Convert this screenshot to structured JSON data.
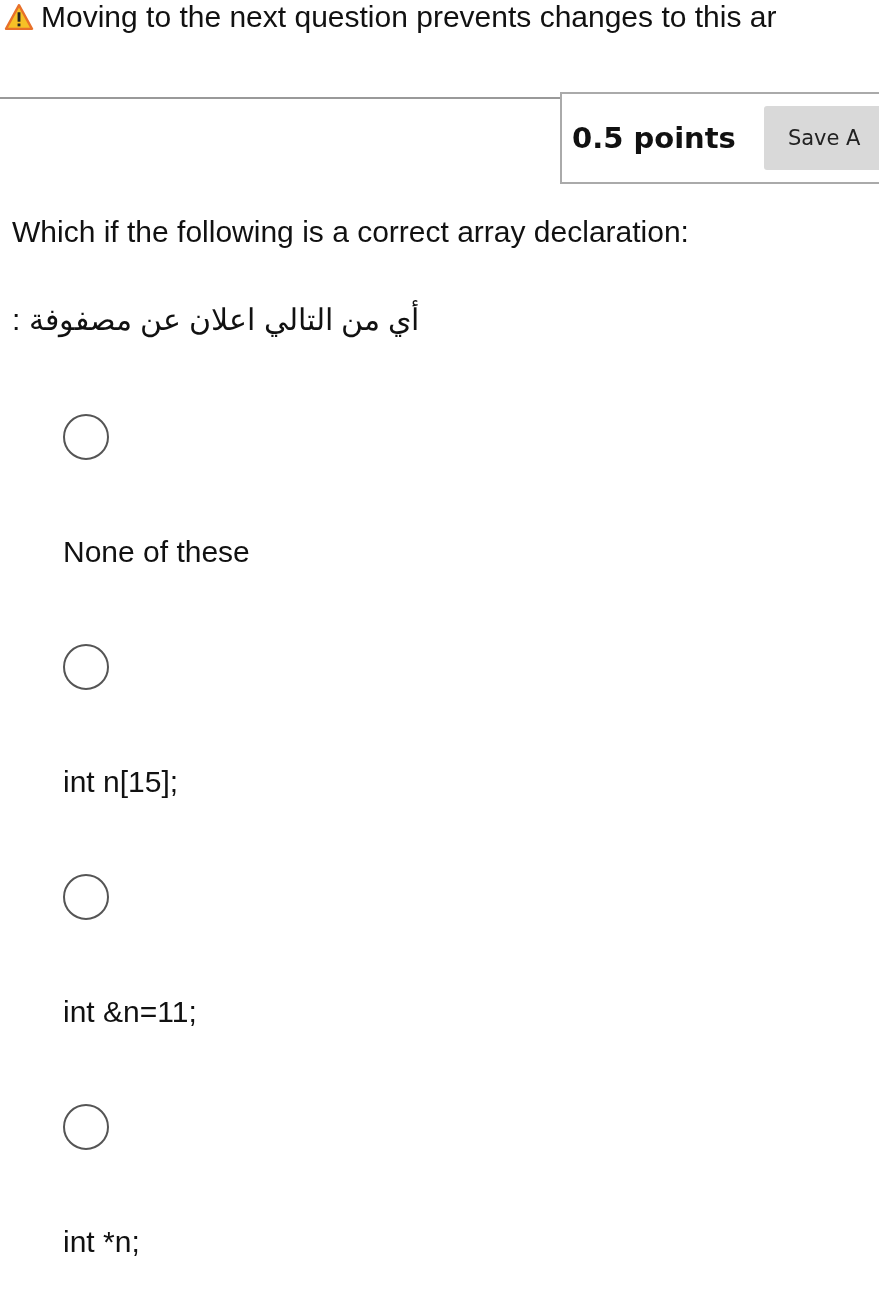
{
  "warning": "Moving to the next question prevents changes to this ar",
  "points": "0.5 points",
  "save_button": "Save A",
  "question": "Which if the following is a correct array declaration:",
  "question_ar": "أي من التالي اعلان عن مصفوفة :",
  "options": [
    {
      "label": "None of these",
      "selected": false
    },
    {
      "label": "int n[15];",
      "selected": false
    },
    {
      "label": "int &n=11;",
      "selected": false
    },
    {
      "label": "int *n;",
      "selected": false
    }
  ]
}
